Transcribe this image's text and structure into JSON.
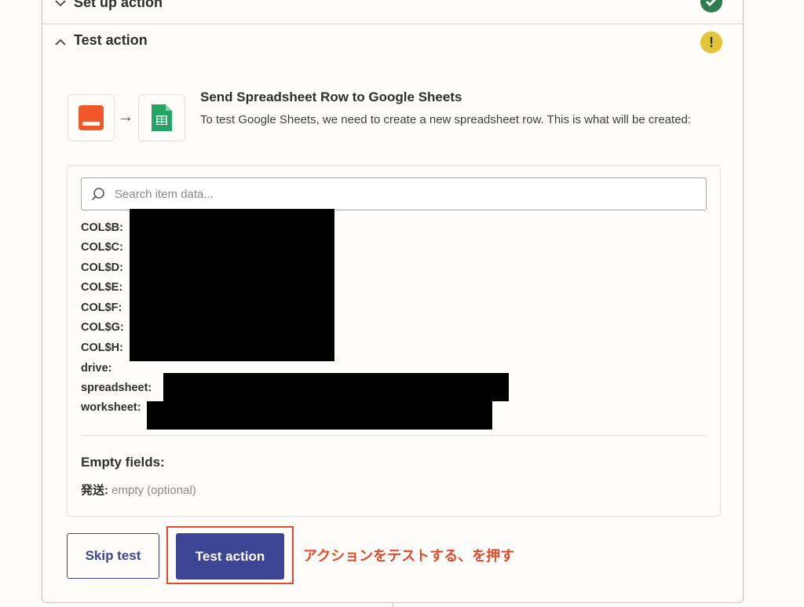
{
  "sections": {
    "setup": {
      "title": "Set up action",
      "status": "complete"
    },
    "test": {
      "title": "Test action",
      "status": "warning",
      "status_glyph": "!"
    }
  },
  "test_action": {
    "title": "Send Spreadsheet Row to Google Sheets",
    "description": "To test Google Sheets, we need to create a new spreadsheet row. This is what will be created:",
    "source_app_icon": "orange-app-icon",
    "target_app_icon": "google-sheets-icon",
    "arrow": "→"
  },
  "search": {
    "placeholder": "Search item data..."
  },
  "fields": [
    {
      "label": "COL$B:",
      "redacted": true
    },
    {
      "label": "COL$C:",
      "redacted": true
    },
    {
      "label": "COL$D:",
      "redacted": true
    },
    {
      "label": "COL$E:",
      "redacted": true
    },
    {
      "label": "COL$F:",
      "redacted": true
    },
    {
      "label": "COL$G:",
      "redacted": true
    },
    {
      "label": "COL$H:",
      "redacted": true
    },
    {
      "label": "drive:",
      "redacted": false
    },
    {
      "label": "spreadsheet:",
      "redacted": true
    },
    {
      "label": "worksheet:",
      "redacted": true
    }
  ],
  "empty_fields": {
    "title": "Empty fields:",
    "items": [
      {
        "key": "発送:",
        "value": "empty (optional)"
      }
    ]
  },
  "buttons": {
    "skip": "Skip test",
    "test": "Test action"
  },
  "annotation": "アクションをテストする、を押す",
  "colors": {
    "accent": "#3c4594",
    "annotation": "#e34b2f",
    "ok": "#2f7d4e",
    "warn": "#e3c53a"
  }
}
